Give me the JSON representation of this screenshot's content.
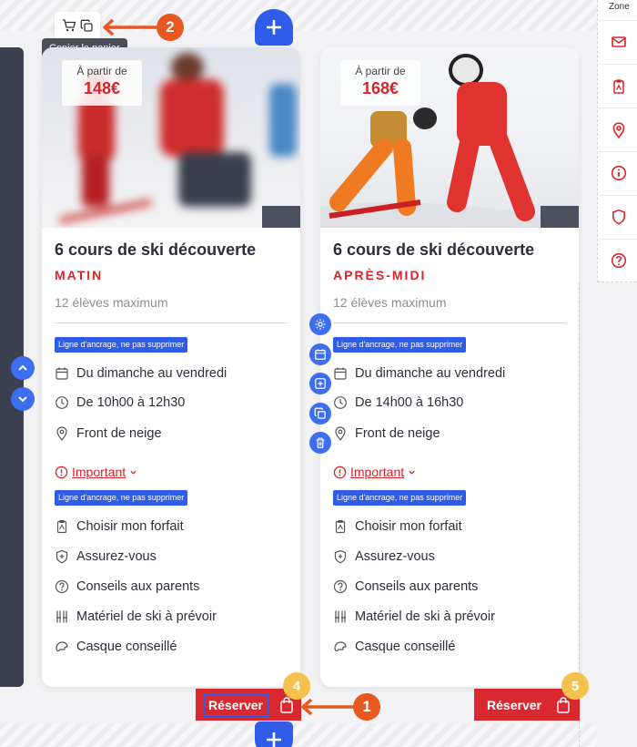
{
  "cart_tooltip": "Copier le panier",
  "zone_label": "Zone",
  "cards": [
    {
      "price_label": "À partir de",
      "price": "148€",
      "title": "6 cours de ski découverte",
      "session": "MATIN",
      "capacity": "12 élèves maximum",
      "anchor_label": "Ligne d'ancrage, ne pas supprimer",
      "schedule": [
        {
          "icon": "calendar-icon",
          "text": "Du dimanche au vendredi"
        },
        {
          "icon": "clock-icon",
          "text": "De 10h00 à 12h30"
        },
        {
          "icon": "location-icon",
          "text": "Front de neige"
        }
      ],
      "important_label": "Important",
      "links": [
        {
          "icon": "ski-pass-icon",
          "text": "Choisir mon forfait"
        },
        {
          "icon": "shield-icon",
          "text": "Assurez-vous"
        },
        {
          "icon": "question-icon",
          "text": "Conseils aux parents"
        },
        {
          "icon": "ski-gear-icon",
          "text": "Matériel de ski à prévoir"
        },
        {
          "icon": "helmet-icon",
          "text": "Casque conseillé"
        }
      ],
      "reserve_label": "Réserver"
    },
    {
      "price_label": "À partir de",
      "price": "168€",
      "title": "6 cours de ski découverte",
      "session": "APRÈS-MIDI",
      "capacity": "12 élèves maximum",
      "anchor_label": "Ligne d'ancrage, ne pas supprimer",
      "schedule": [
        {
          "icon": "calendar-icon",
          "text": "Du dimanche au vendredi"
        },
        {
          "icon": "clock-icon",
          "text": "De 14h00 à 16h30"
        },
        {
          "icon": "location-icon",
          "text": "Front de neige"
        }
      ],
      "important_label": "Important",
      "links": [
        {
          "icon": "ski-pass-icon",
          "text": "Choisir mon forfait"
        },
        {
          "icon": "shield-icon",
          "text": "Assurez-vous"
        },
        {
          "icon": "question-icon",
          "text": "Conseils aux parents"
        },
        {
          "icon": "ski-gear-icon",
          "text": "Matériel de ski à prévoir"
        },
        {
          "icon": "helmet-icon",
          "text": "Casque conseillé"
        }
      ],
      "reserve_label": "Réserver"
    }
  ],
  "annotations": {
    "step_1": "1",
    "step_2": "2",
    "badge_4": "4",
    "badge_5": "5"
  },
  "colors": {
    "accent": "#d8232a",
    "editor_blue": "#2f5ce8",
    "arrow_orange": "#e8571e",
    "badge_yellow": "#f6c04c"
  }
}
